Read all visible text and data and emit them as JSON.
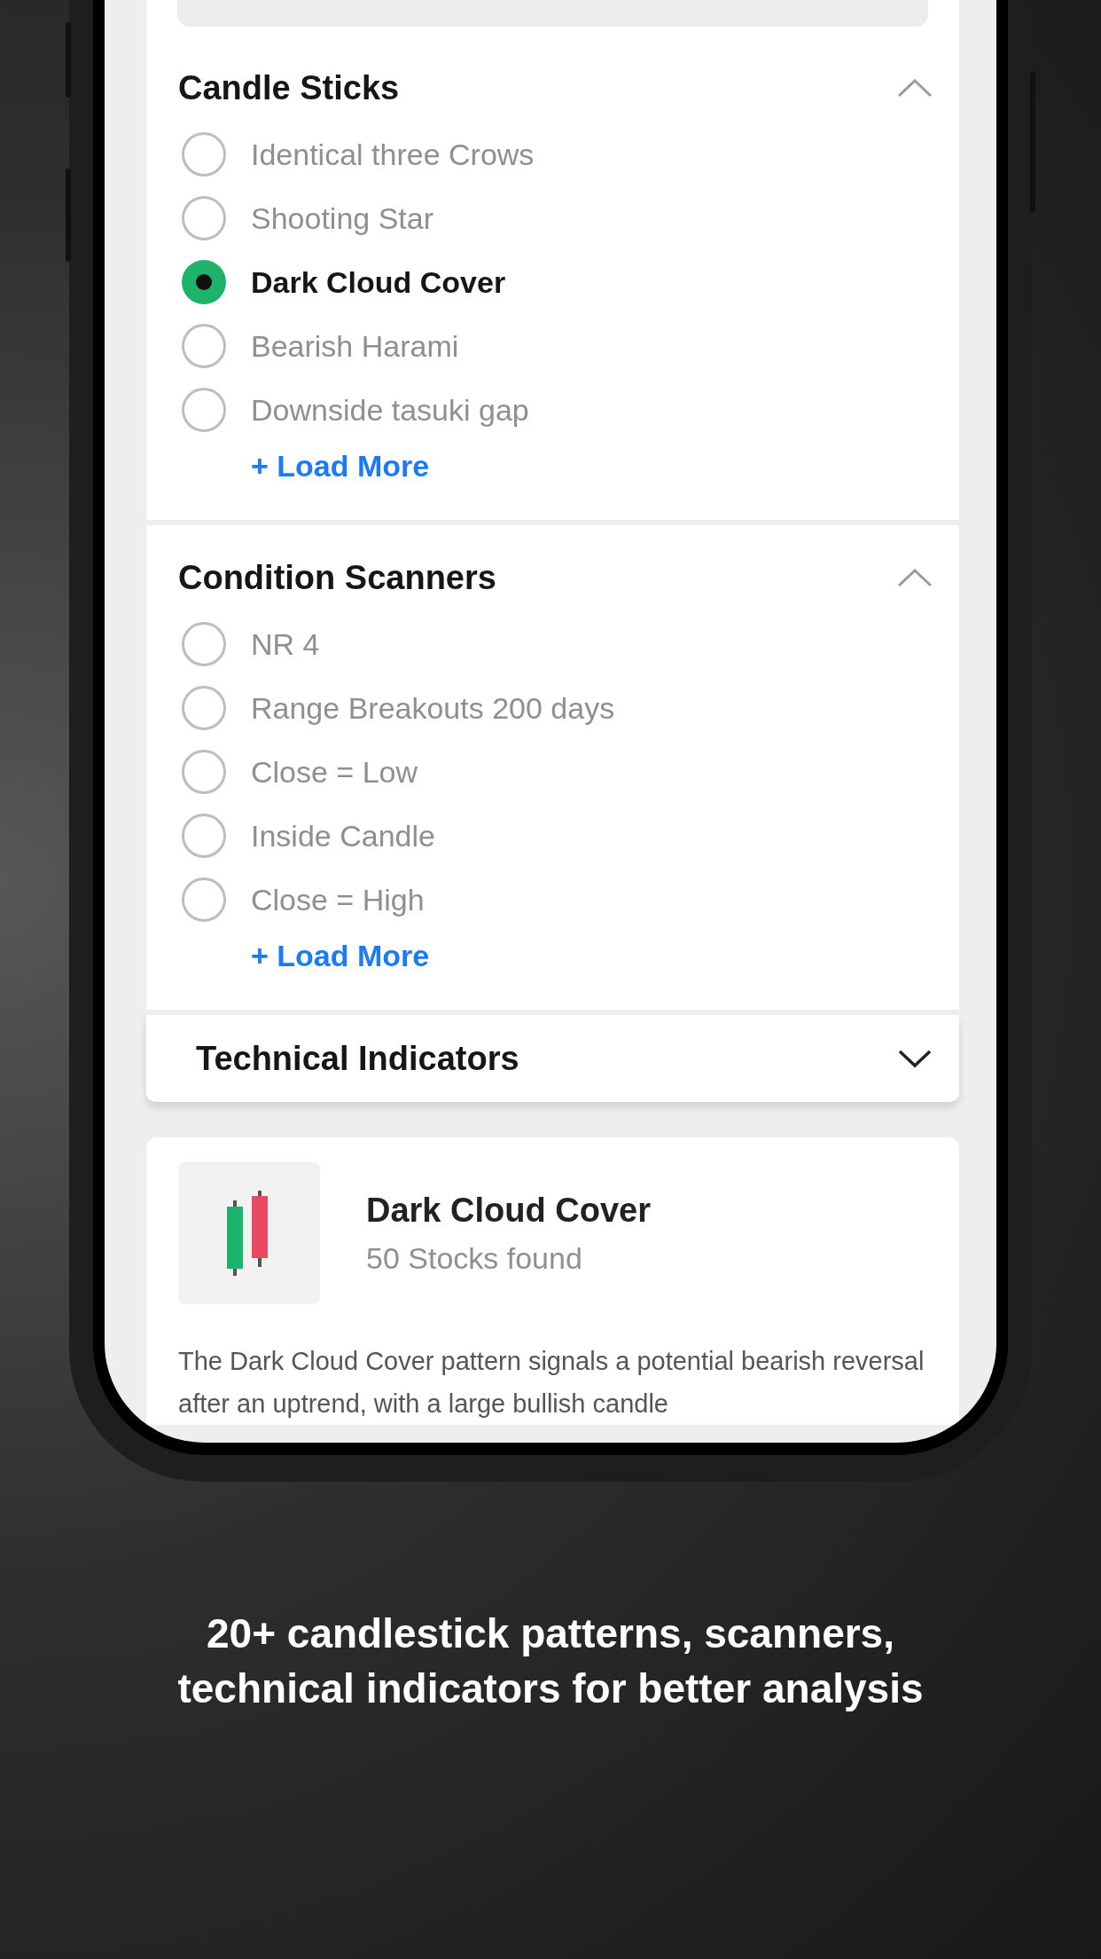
{
  "sections": [
    {
      "title": "Candle Sticks",
      "expanded": true,
      "options": [
        {
          "label": "Identical three Crows",
          "selected": false
        },
        {
          "label": "Shooting Star",
          "selected": false
        },
        {
          "label": "Dark Cloud Cover",
          "selected": true
        },
        {
          "label": "Bearish Harami",
          "selected": false
        },
        {
          "label": "Downside tasuki gap",
          "selected": false
        }
      ],
      "load_more": "+ Load More"
    },
    {
      "title": "Condition Scanners",
      "expanded": true,
      "options": [
        {
          "label": "NR 4",
          "selected": false
        },
        {
          "label": "Range Breakouts 200 days",
          "selected": false
        },
        {
          "label": "Close = Low",
          "selected": false
        },
        {
          "label": "Inside Candle",
          "selected": false
        },
        {
          "label": "Close = High",
          "selected": false
        }
      ],
      "load_more": "+ Load More"
    },
    {
      "title": "Technical Indicators",
      "expanded": false
    }
  ],
  "result": {
    "title": "Dark Cloud Cover",
    "subtitle": "50 Stocks found",
    "description": "The Dark Cloud Cover pattern signals a potential bearish reversal after an uptrend, with a large bullish candle"
  },
  "caption": [
    "20+ candlestick patterns, scanners,",
    "technical indicators for better analysis"
  ]
}
